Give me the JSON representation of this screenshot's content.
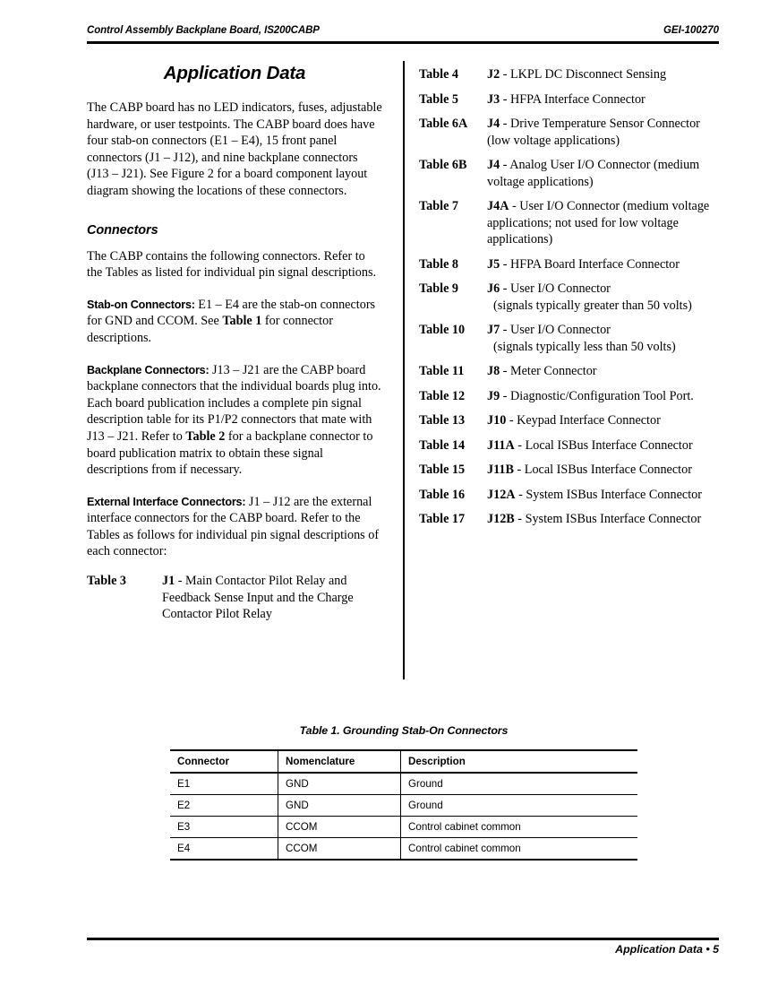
{
  "header": {
    "left": "Control Assembly Backplane Board, IS200CABP",
    "right": "GEI-100270"
  },
  "left_column": {
    "section_title": "Application Data",
    "intro_paragraph": "The CABP board has no LED indicators, fuses, adjustable hardware, or user testpoints. The CABP board does have four stab-on connectors (E1 – E4), 15 front panel connectors (J1 – J12), and nine backplane connectors (J13 – J21). See Figure 2 for a board component layout diagram showing the locations of these connectors.",
    "connectors_heading": "Connectors",
    "connectors_paragraph": "The CABP contains the following connectors. Refer to the Tables as listed for individual pin signal descriptions.",
    "stab_on": {
      "lead_in": "Stab-on Connectors:",
      "text_before_bold": "  E1 – E4 are the stab-on connectors for GND and CCOM. See ",
      "bold_ref": "Table 1",
      "text_after_bold": " for connector descriptions."
    },
    "backplane": {
      "lead_in": "Backplane Connectors:",
      "text_before_bold": "  J13 – J21 are the CABP board backplane connectors that the individual boards plug into. Each board publication includes a complete pin signal description table for its P1/P2 connectors that mate with J13 – J21. Refer to ",
      "bold_ref": "Table 2",
      "text_after_bold": " for a backplane connector to board publication matrix to obtain these signal descriptions from if necessary."
    },
    "external": {
      "lead_in": "External Interface Connectors:",
      "text": "  J1 – J12 are the external interface connectors for the CABP board. Refer to the Tables as follows for individual pin signal descriptions of each connector:"
    },
    "table_refs": [
      {
        "label": "Table 3",
        "conn": "J1",
        "desc": " - Main Contactor Pilot Relay and Feedback Sense Input and the Charge Contactor Pilot Relay",
        "desc2": ""
      }
    ]
  },
  "right_column": {
    "table_refs": [
      {
        "label": "Table 4",
        "conn": "J2",
        "desc": " - LKPL DC Disconnect Sensing",
        "desc2": ""
      },
      {
        "label": "Table 5",
        "conn": "J3",
        "desc": " - HFPA Interface Connector",
        "desc2": ""
      },
      {
        "label": "Table 6A",
        "conn": "J4",
        "desc": " - Drive Temperature Sensor Connector (low voltage applications)",
        "desc2": ""
      },
      {
        "label": "Table 6B",
        "conn": "J4",
        "desc": " - Analog User I/O Connector (medium voltage applications)",
        "desc2": ""
      },
      {
        "label": "Table 7",
        "conn": "J4A",
        "desc": " - User I/O Connector (medium voltage applications; not used for low voltage applications)",
        "desc2": ""
      },
      {
        "label": "Table 8",
        "conn": "J5",
        "desc": " - HFPA Board Interface Connector",
        "desc2": ""
      },
      {
        "label": "Table 9",
        "conn": "J6",
        "desc": " - User I/O Connector",
        "desc2": "(signals typically greater than 50 volts)"
      },
      {
        "label": "Table 10",
        "conn": "J7",
        "desc": " - User I/O Connector",
        "desc2": "(signals typically less than 50 volts)"
      },
      {
        "label": "Table 11",
        "conn": "J8",
        "desc": " - Meter Connector",
        "desc2": ""
      },
      {
        "label": "Table 12",
        "conn": "J9",
        "desc": " - Diagnostic/Configuration Tool Port.",
        "desc2": ""
      },
      {
        "label": "Table 13",
        "conn": "J10",
        "desc": " - Keypad Interface Connector",
        "desc2": ""
      },
      {
        "label": "Table 14",
        "conn": "J11A",
        "desc": " - Local ISBus Interface Connector",
        "desc2": ""
      },
      {
        "label": "Table 15",
        "conn": "J11B",
        "desc": " - Local ISBus Interface Connector",
        "desc2": ""
      },
      {
        "label": "Table 16",
        "conn": "J12A",
        "desc": " - System ISBus Interface Connector",
        "desc2": ""
      },
      {
        "label": "Table 17",
        "conn": "J12B",
        "desc": " - System ISBus Interface Connector",
        "desc2": ""
      }
    ]
  },
  "table1": {
    "caption": "Table 1.  Grounding Stab-On Connectors",
    "columns": [
      "Connector",
      "Nomenclature",
      "Description"
    ],
    "rows": [
      [
        "E1",
        "GND",
        "Ground"
      ],
      [
        "E2",
        "GND",
        "Ground"
      ],
      [
        "E3",
        "CCOM",
        "Control cabinet common"
      ],
      [
        "E4",
        "CCOM",
        "Control cabinet common"
      ]
    ]
  },
  "footer": {
    "right": "Application Data • 5"
  }
}
